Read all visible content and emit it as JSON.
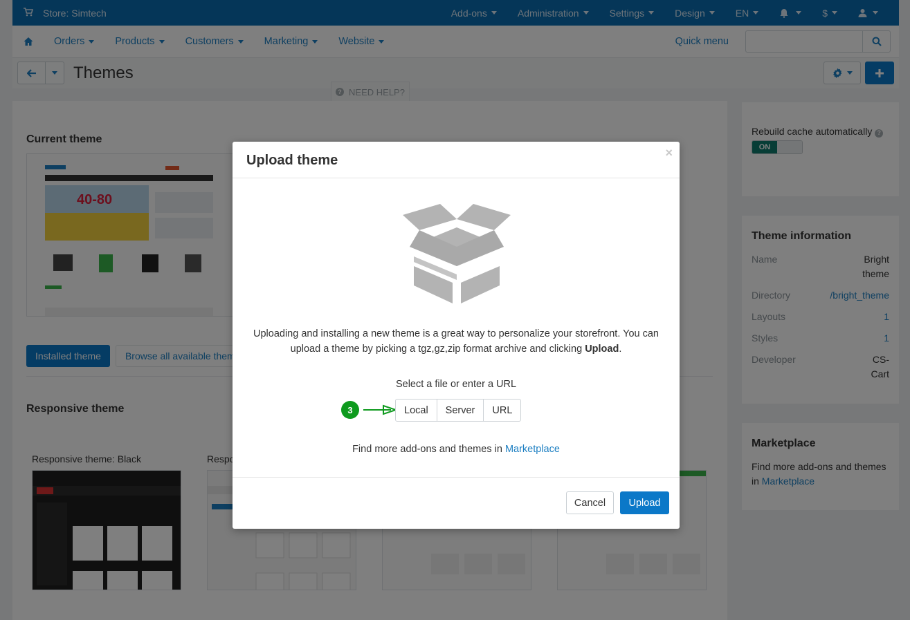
{
  "topbar": {
    "store": "Store: Simtech",
    "menus": [
      "Add-ons",
      "Administration",
      "Settings",
      "Design",
      "EN"
    ],
    "currency": "$",
    "color": "#0a6cb1"
  },
  "navbar": {
    "items": [
      "Orders",
      "Products",
      "Customers",
      "Marketing",
      "Website"
    ],
    "quick_menu": "Quick menu",
    "search_placeholder": ""
  },
  "page": {
    "title": "Themes",
    "need_help": "NEED HELP?"
  },
  "main": {
    "current_theme_title": "Current theme",
    "tabs": [
      "Installed theme",
      "Browse all available them"
    ],
    "responsive_title": "Responsive theme",
    "theme_cards": [
      "Responsive theme: Black",
      "Respo"
    ]
  },
  "sidebar": {
    "rebuild_cache": "Rebuild cache automatically",
    "toggle_on": "ON",
    "theme_info_title": "Theme information",
    "info": [
      {
        "k": "Name",
        "v": "Bright theme"
      },
      {
        "k": "Directory",
        "v": "/bright_theme"
      },
      {
        "k": "Layouts",
        "v": "1"
      },
      {
        "k": "Styles",
        "v": "1"
      },
      {
        "k": "Developer",
        "v": "CS-Cart"
      }
    ],
    "marketplace_title": "Marketplace",
    "marketplace_text": "Find more add-ons and themes in",
    "marketplace_link": "Marketplace"
  },
  "modal": {
    "title": "Upload theme",
    "close": "×",
    "desc_part1": "Uploading and installing a new theme is a great way to personalize your storefront. You can upload a theme by picking a tgz,gz,zip format archive and clicking",
    "desc_bold": "Upload",
    "desc_end": ".",
    "select_label": "Select a file or enter a URL",
    "step_number": "3",
    "sources": [
      "Local",
      "Server",
      "URL"
    ],
    "find_text": "Find more add-ons and themes in",
    "find_link": "Marketplace",
    "cancel": "Cancel",
    "upload": "Upload",
    "accent": "#0b78c8",
    "step_color": "#0e9a1e"
  }
}
